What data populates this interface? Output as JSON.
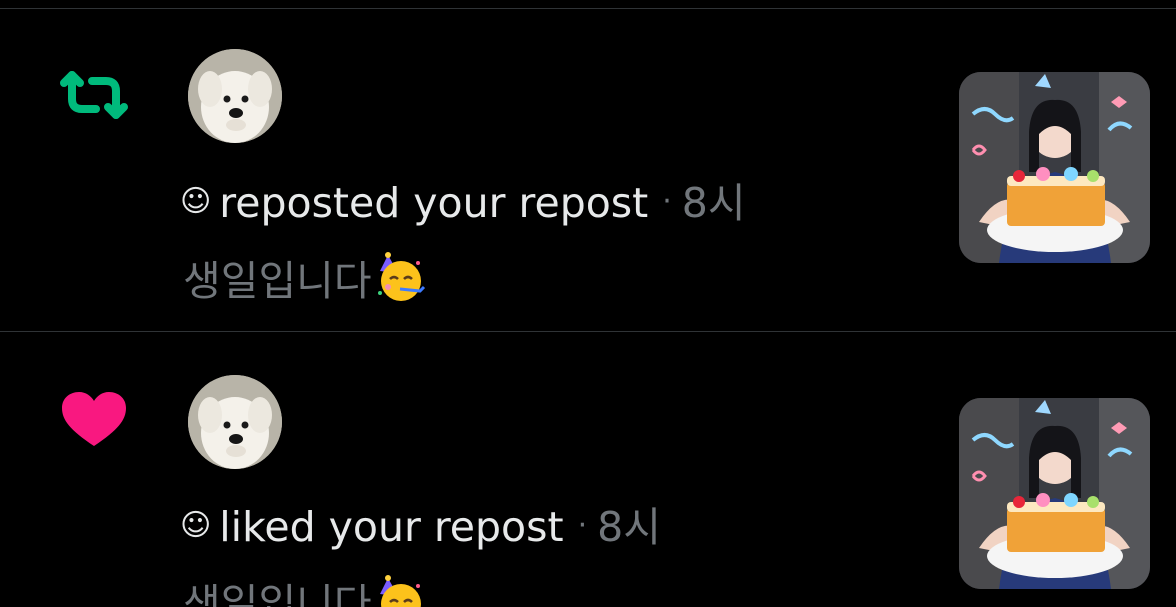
{
  "notifications": [
    {
      "type": "repost",
      "type_icon": "repost-icon",
      "type_color": "#00ba7c",
      "avatar_icon": "white-puppy-avatar",
      "user_marker": "☺",
      "action_text": "reposted your repost",
      "separator": "·",
      "time": "8시",
      "post_text": "생일입니다",
      "post_emoji": "partying-face-emoji",
      "thumbnail": "birthday-cake-photo"
    },
    {
      "type": "like",
      "type_icon": "heart-icon",
      "type_color": "#f91880",
      "avatar_icon": "white-puppy-avatar",
      "user_marker": "☺",
      "action_text": "liked your repost",
      "separator": "·",
      "time": "8시",
      "post_text": "생일입니다",
      "post_emoji": "partying-face-emoji",
      "thumbnail": "birthday-cake-photo"
    }
  ]
}
